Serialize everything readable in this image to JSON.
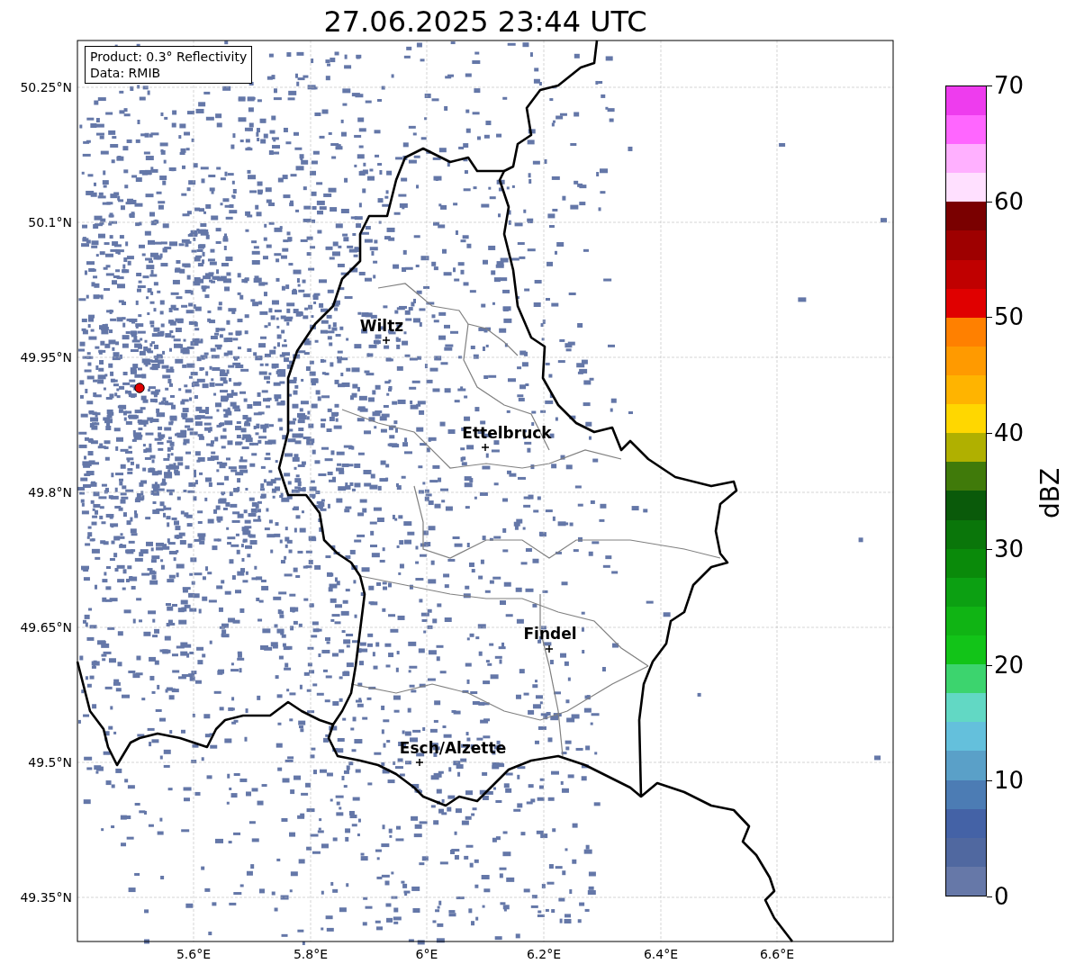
{
  "title": "27.06.2025 23:44 UTC",
  "legend": {
    "lines": [
      "Product: 0.3° Reflectivity",
      "Data: RMIB"
    ]
  },
  "lat_labels": [
    "50.25°N",
    "50.1°N",
    "49.95°N",
    "49.8°N",
    "49.65°N",
    "49.5°N",
    "49.35°N"
  ],
  "lon_labels": [
    "5.6°E",
    "5.8°E",
    "6°E",
    "6.2°E",
    "6.4°E",
    "6.6°E"
  ],
  "cities": [
    {
      "name": "Wiltz"
    },
    {
      "name": "Ettelbruck"
    },
    {
      "name": "Findel"
    },
    {
      "name": "Esch/Alzette"
    }
  ],
  "colorbar": {
    "label": "dBZ",
    "ticks": [
      "70",
      "60",
      "50",
      "40",
      "30",
      "20",
      "10",
      "0"
    ],
    "bins": [
      {
        "color": "#6678a8"
      },
      {
        "color": "#5068a0"
      },
      {
        "color": "#4462a6"
      },
      {
        "color": "#4c7cb4"
      },
      {
        "color": "#5aa0c8"
      },
      {
        "color": "#64c0dc"
      },
      {
        "color": "#62d8c4"
      },
      {
        "color": "#3cd46e"
      },
      {
        "color": "#12c418"
      },
      {
        "color": "#10b414"
      },
      {
        "color": "#0ca012"
      },
      {
        "color": "#0a8a0a"
      },
      {
        "color": "#0a760a"
      },
      {
        "color": "#0a5a0a"
      },
      {
        "color": "#407a0a"
      },
      {
        "color": "#b0b000"
      },
      {
        "color": "#ffd700"
      },
      {
        "color": "#ffb400"
      },
      {
        "color": "#ff9a00"
      },
      {
        "color": "#ff8000"
      },
      {
        "color": "#e00000"
      },
      {
        "color": "#c00000"
      },
      {
        "color": "#9e0000"
      },
      {
        "color": "#7a0000"
      },
      {
        "color": "#ffe0ff"
      },
      {
        "color": "#ffb0ff"
      },
      {
        "color": "#ff66ff"
      },
      {
        "color": "#ee3cee"
      }
    ]
  }
}
